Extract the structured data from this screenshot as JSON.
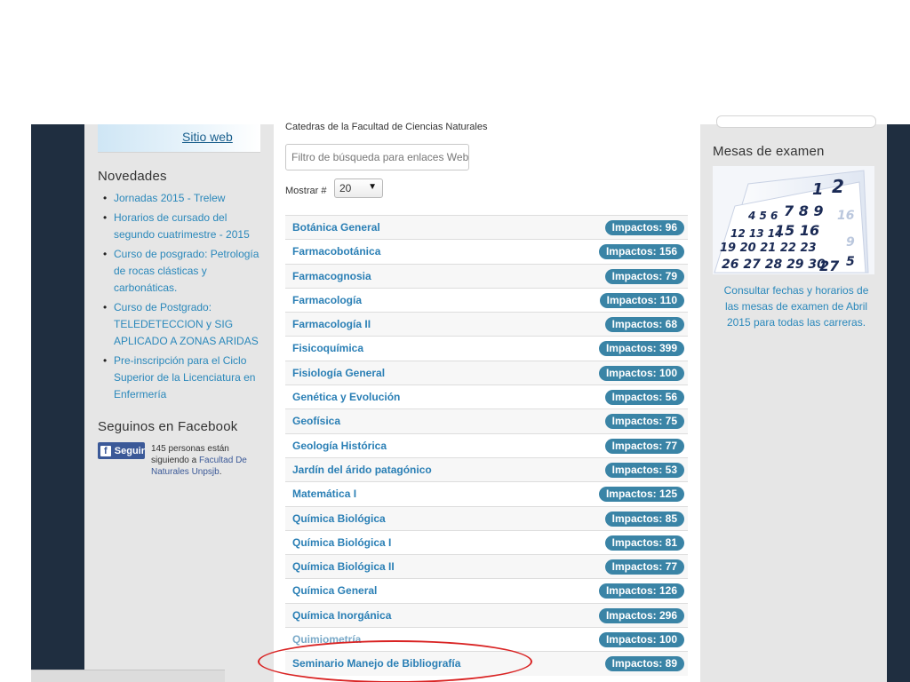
{
  "left": {
    "site_link": "Sitio web",
    "news_title": "Novedades",
    "news": [
      "Jornadas 2015 - Trelew",
      "Horarios de cursado del segundo cuatrimestre - 2015",
      "Curso de posgrado: Petrología de rocas clásticas y carbonáticas.",
      "Curso de Postgrado: TELEDETECCION y SIG APLICADO A ZONAS ARIDAS",
      "Pre-inscripción para el Ciclo Superior de la Licenciatura en Enfermería"
    ],
    "facebook_title": "Seguinos en Facebook",
    "fb_button": "Seguir",
    "fb_text_1": "145 personas están siguiendo a ",
    "fb_text_link": "Facultad De Naturales Unpsjb",
    "fb_text_2": "."
  },
  "center": {
    "title": "Catedras de la Facultad de Ciencias Naturales",
    "filter_placeholder": "Filtro de búsqueda para enlaces Web",
    "show_label": "Mostrar #",
    "show_value": "20",
    "rows": [
      {
        "name": "Botánica General",
        "hits": "Impactos: 96"
      },
      {
        "name": "Farmacobotánica",
        "hits": "Impactos: 156"
      },
      {
        "name": "Farmacognosia",
        "hits": "Impactos: 79"
      },
      {
        "name": "Farmacología",
        "hits": "Impactos: 110"
      },
      {
        "name": "Farmacología II",
        "hits": "Impactos: 68"
      },
      {
        "name": "Fisicoquímica",
        "hits": "Impactos: 399"
      },
      {
        "name": "Fisiología General",
        "hits": "Impactos: 100"
      },
      {
        "name": "Genética y Evolución",
        "hits": "Impactos: 56"
      },
      {
        "name": "Geofísica",
        "hits": "Impactos: 75"
      },
      {
        "name": "Geología Histórica",
        "hits": "Impactos: 77"
      },
      {
        "name": "Jardín del árido patagónico",
        "hits": "Impactos: 53"
      },
      {
        "name": "Matemática I",
        "hits": "Impactos: 125"
      },
      {
        "name": "Química Biológica",
        "hits": "Impactos: 85"
      },
      {
        "name": "Química Biológica I",
        "hits": "Impactos: 81"
      },
      {
        "name": "Química Biológica II",
        "hits": "Impactos: 77"
      },
      {
        "name": "Química General",
        "hits": "Impactos: 126"
      },
      {
        "name": "Química Inorgánica",
        "hits": "Impactos: 296"
      },
      {
        "name": "Quimiometría",
        "hits": "Impactos: 100"
      },
      {
        "name": "Seminario Manejo de Bibliografía",
        "hits": "Impactos: 89"
      }
    ]
  },
  "right": {
    "title": "Mesas de examen",
    "text": "Consultar fechas y horarios de las mesas de examen de Abril 2015 para todas las carreras."
  },
  "colors": {
    "link": "#2a7fb5",
    "badge": "#3a84a6",
    "highlight": "#d92323",
    "facebook": "#3b5998"
  }
}
